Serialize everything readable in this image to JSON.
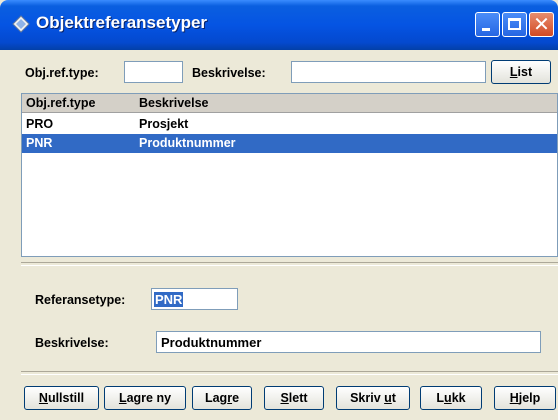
{
  "window": {
    "title": "Objektreferansetyper",
    "controls": [
      "minimize-icon",
      "maximize-icon",
      "close-icon"
    ]
  },
  "filter": {
    "type_label": "Obj.ref.type:",
    "type_value": "",
    "desc_label": "Beskrivelse:",
    "desc_value": "",
    "list_button": {
      "pre": "",
      "u": "L",
      "post": "ist"
    }
  },
  "list": {
    "columns": [
      "Obj.ref.type",
      "Beskrivelse"
    ],
    "rows": [
      {
        "type": "PRO",
        "description": "Prosjekt",
        "selected": false
      },
      {
        "type": "PNR",
        "description": "Produktnummer",
        "selected": true
      }
    ]
  },
  "detail": {
    "ref_label": "Referansetype:",
    "ref_value": "PNR",
    "desc_label": "Beskrivelse:",
    "desc_value": "Produktnummer"
  },
  "buttons": [
    {
      "pre": "",
      "u": "N",
      "post": "ullstill"
    },
    {
      "pre": "",
      "u": "L",
      "post": "agre ny"
    },
    {
      "pre": "Lag",
      "u": "r",
      "post": "e"
    },
    {
      "pre": "",
      "u": "S",
      "post": "lett"
    },
    {
      "pre": "Skriv ",
      "u": "u",
      "post": "t"
    },
    {
      "pre": "L",
      "u": "u",
      "post": "kk"
    },
    {
      "pre": "",
      "u": "H",
      "post": "jelp"
    }
  ],
  "colors": {
    "title_bar": "#0554E3",
    "selection": "#316AC5",
    "face": "#ECE9D8"
  }
}
